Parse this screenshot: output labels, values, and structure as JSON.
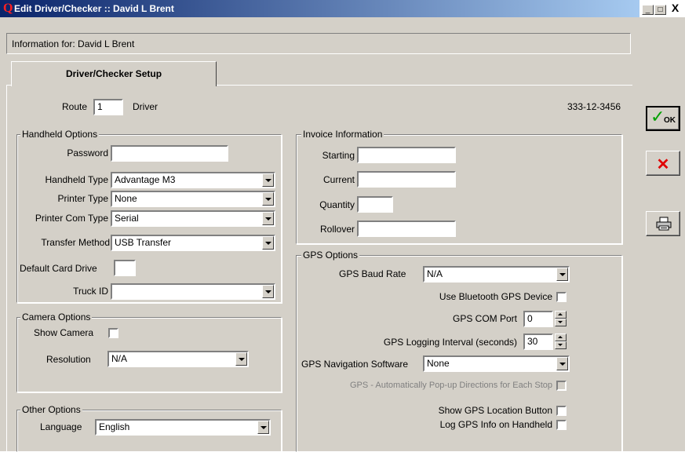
{
  "window": {
    "title": "Edit Driver/Checker :: David L Brent",
    "app_icon": "Q",
    "controls": {
      "minimize": "_",
      "maximize": "□",
      "close": "X"
    }
  },
  "info": {
    "text": "Information for: David L Brent"
  },
  "tabs": [
    {
      "label": "Driver/Checker Setup",
      "active": true
    }
  ],
  "route": {
    "label": "Route",
    "value": "1",
    "role": "Driver",
    "ssn": "333-12-3456"
  },
  "handheld": {
    "title": "Handheld Options",
    "password_label": "Password",
    "password_value": "",
    "type_label": "Handheld Type",
    "type_value": "Advantage M3",
    "printer_label": "Printer Type",
    "printer_value": "None",
    "com_label": "Printer Com Type",
    "com_value": "Serial",
    "transfer_label": "Transfer Method",
    "transfer_value": "USB Transfer",
    "card_label": "Default Card Drive",
    "card_value": "",
    "truck_label": "Truck ID",
    "truck_value": ""
  },
  "camera": {
    "title": "Camera Options",
    "show_label": "Show Camera",
    "show_checked": false,
    "resolution_label": "Resolution",
    "resolution_value": "N/A"
  },
  "other": {
    "title": "Other Options",
    "language_label": "Language",
    "language_value": "English"
  },
  "invoice": {
    "title": "Invoice Information",
    "starting_label": "Starting",
    "starting_value": "",
    "current_label": "Current",
    "current_value": "",
    "quantity_label": "Quantity",
    "quantity_value": "",
    "rollover_label": "Rollover",
    "rollover_value": ""
  },
  "gps": {
    "title": "GPS Options",
    "baud_label": "GPS Baud Rate",
    "baud_value": "N/A",
    "bluetooth_label": "Use Bluetooth GPS Device",
    "bluetooth_checked": false,
    "com_port_label": "GPS COM Port",
    "com_port_value": "0",
    "interval_label": "GPS Logging Interval (seconds)",
    "interval_value": "30",
    "nav_label": "GPS Navigation Software",
    "nav_value": "None",
    "popup_label": "GPS - Automatically Pop-up Directions for Each Stop",
    "popup_checked": false,
    "popup_disabled": true,
    "location_btn_label": "Show GPS Location Button",
    "location_btn_checked": false,
    "log_label": "Log GPS Info on Handheld",
    "log_checked": false
  },
  "buttons": {
    "ok": "OK",
    "cancel_icon": "x-icon",
    "print_icon": "printer-icon"
  },
  "colors": {
    "accent": "#0a246a",
    "cancel": "#e00000",
    "ok_check": "#00a000"
  }
}
